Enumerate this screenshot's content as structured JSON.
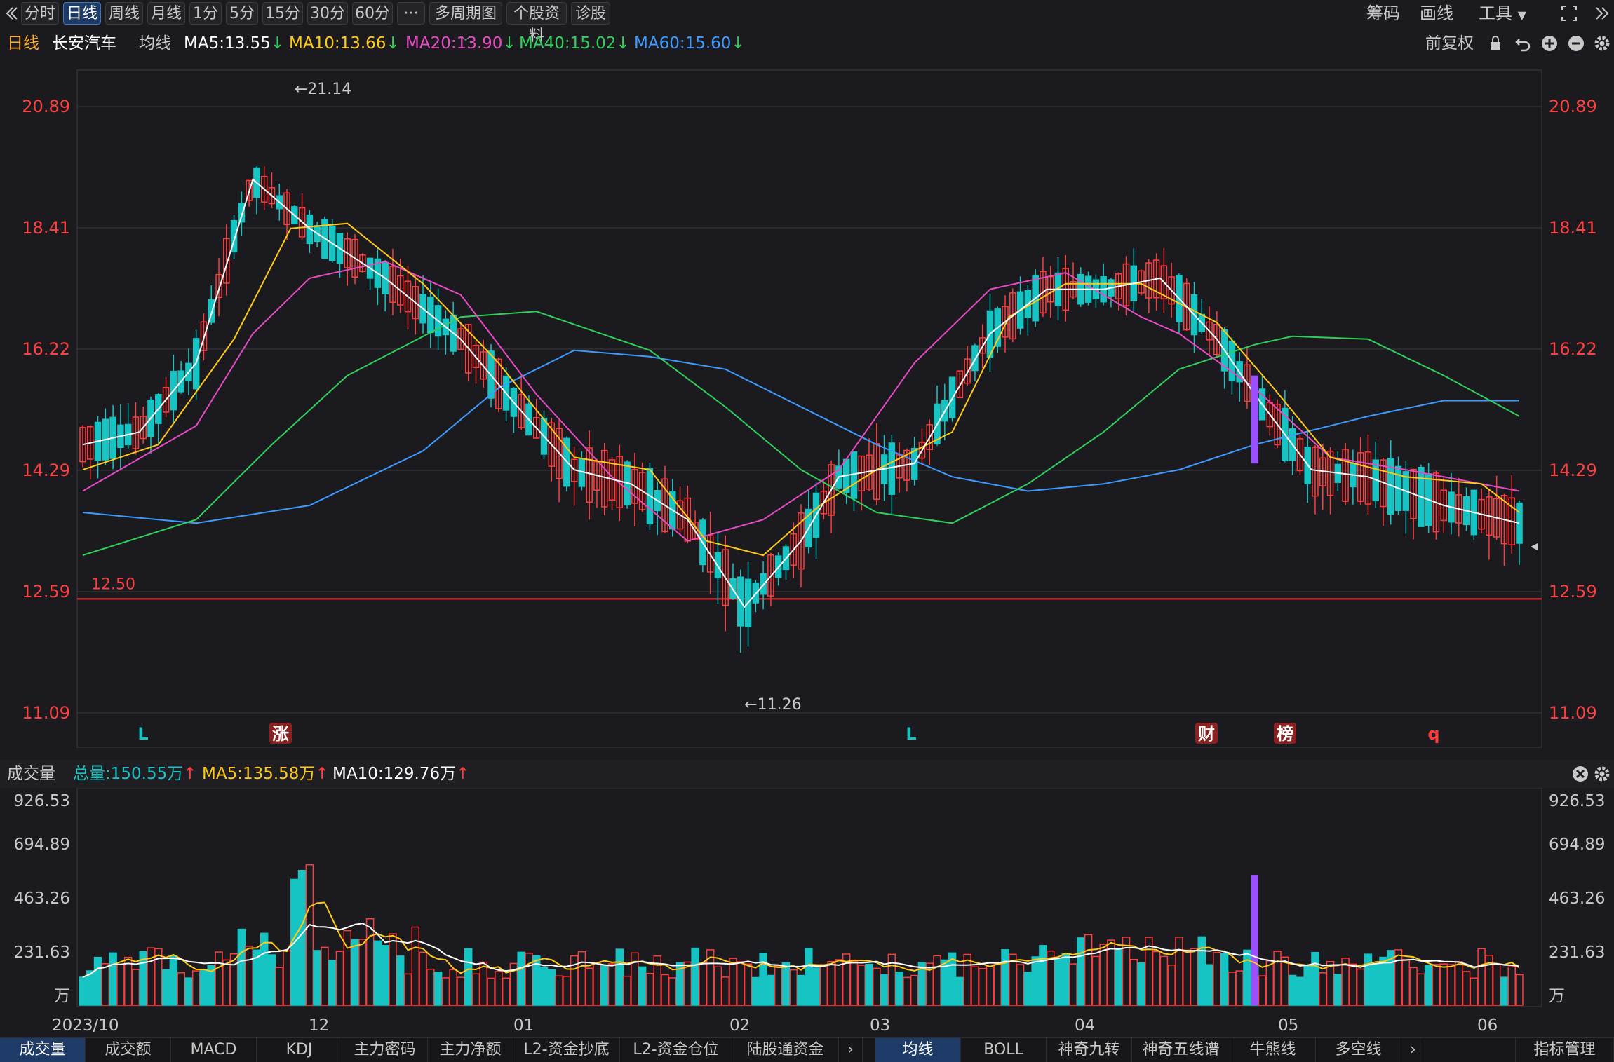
{
  "toolbar": {
    "back_icon": "chevron-left-icon",
    "periods": [
      "分时",
      "日线",
      "周线",
      "月线",
      "1分",
      "5分",
      "15分",
      "30分",
      "60分"
    ],
    "active_period": "日线",
    "more": "···",
    "multi_period": "多周期图",
    "stock_info": "个股资料",
    "diagnose": "诊股",
    "chips": "筹码",
    "draw": "画线",
    "tools": "工具",
    "expand_icon": "fullscreen-icon",
    "collapse_icon": "chevron-right-double-icon"
  },
  "price_header": {
    "period": "日线",
    "stock_name": "长安汽车",
    "avg_label": "均线",
    "ma5": "MA5:13.55",
    "ma10": "MA10:13.66",
    "ma20": "MA20:13.90",
    "ma40": "MA40:15.02",
    "ma60": "MA60:15.60",
    "adjust": "前复权",
    "lock_icon": "lock-icon",
    "undo_icon": "undo-icon",
    "zoom_in_icon": "plus-circle-icon",
    "zoom_out_icon": "minus-circle-icon",
    "settings_icon": "gear-icon"
  },
  "volume_header": {
    "title": "成交量",
    "total": "总量:150.55万",
    "ma5": "MA5:135.58万",
    "ma10": "MA10:129.76万",
    "close_icon": "close-icon",
    "settings_icon": "gear-icon"
  },
  "colors": {
    "up": "#ff3b3b",
    "down": "#16c4c4",
    "ma5": "#ffffff",
    "ma10": "#ffc916",
    "ma20": "#e84ac4",
    "ma40": "#2fcf5b",
    "ma60": "#3d9bff",
    "grid": "#3a3a3f",
    "axis": "#ff4040",
    "marker": "#9b4fff"
  },
  "chart_data": [
    {
      "type": "candlestick",
      "title": "长安汽车 日线",
      "y_ticks": [
        "20.89",
        "18.41",
        "16.22",
        "14.29",
        "12.59",
        "11.09"
      ],
      "ylim": [
        11.09,
        20.89
      ],
      "x_ticks": [
        "2023/10",
        "12",
        "01",
        "02",
        "03",
        "04",
        "05",
        "06"
      ],
      "annotations": {
        "high": "←21.14",
        "low": "←11.26",
        "level": "12.50"
      },
      "level_value": 12.5,
      "events": [
        "L",
        "涨",
        "L",
        "财",
        "榜",
        "q"
      ],
      "series_names": [
        "MA5",
        "MA10",
        "MA20",
        "MA40",
        "MA60"
      ],
      "ma60_points": [
        [
          0,
          13.7
        ],
        [
          30,
          13.55
        ],
        [
          60,
          13.8
        ],
        [
          90,
          14.6
        ],
        [
          110,
          15.6
        ],
        [
          130,
          16.2
        ],
        [
          150,
          16.1
        ],
        [
          170,
          15.9
        ],
        [
          190,
          15.3
        ],
        [
          210,
          14.7
        ],
        [
          230,
          14.2
        ],
        [
          250,
          14.0
        ],
        [
          270,
          14.1
        ],
        [
          290,
          14.3
        ],
        [
          310,
          14.7
        ],
        [
          330,
          15.0
        ],
        [
          340,
          15.15
        ],
        [
          360,
          15.4
        ],
        [
          380,
          15.4
        ]
      ],
      "ma40_points": [
        [
          0,
          13.1
        ],
        [
          30,
          13.6
        ],
        [
          50,
          14.7
        ],
        [
          70,
          15.8
        ],
        [
          100,
          16.8
        ],
        [
          120,
          16.9
        ],
        [
          150,
          16.2
        ],
        [
          170,
          15.3
        ],
        [
          190,
          14.3
        ],
        [
          210,
          13.7
        ],
        [
          230,
          13.55
        ],
        [
          250,
          14.1
        ],
        [
          270,
          14.9
        ],
        [
          290,
          15.9
        ],
        [
          310,
          16.3
        ],
        [
          320,
          16.45
        ],
        [
          340,
          16.4
        ],
        [
          360,
          15.8
        ],
        [
          380,
          15.15
        ]
      ],
      "ma20_points": [
        [
          0,
          14.0
        ],
        [
          30,
          15.0
        ],
        [
          45,
          16.5
        ],
        [
          60,
          17.5
        ],
        [
          80,
          17.8
        ],
        [
          100,
          17.2
        ],
        [
          120,
          15.5
        ],
        [
          140,
          14.2
        ],
        [
          160,
          13.3
        ],
        [
          180,
          13.6
        ],
        [
          200,
          14.3
        ],
        [
          220,
          16.0
        ],
        [
          240,
          17.3
        ],
        [
          260,
          17.6
        ],
        [
          280,
          16.8
        ],
        [
          290,
          16.5
        ],
        [
          310,
          15.6
        ],
        [
          330,
          14.5
        ],
        [
          350,
          14.3
        ],
        [
          380,
          14.0
        ]
      ],
      "ma10_points": [
        [
          0,
          14.3
        ],
        [
          20,
          14.7
        ],
        [
          40,
          16.4
        ],
        [
          55,
          18.4
        ],
        [
          70,
          18.5
        ],
        [
          90,
          17.4
        ],
        [
          110,
          16.0
        ],
        [
          130,
          14.5
        ],
        [
          150,
          14.3
        ],
        [
          165,
          13.3
        ],
        [
          180,
          13.1
        ],
        [
          195,
          13.8
        ],
        [
          210,
          14.3
        ],
        [
          230,
          14.9
        ],
        [
          245,
          16.8
        ],
        [
          260,
          17.4
        ],
        [
          280,
          17.4
        ],
        [
          300,
          16.7
        ],
        [
          315,
          15.6
        ],
        [
          330,
          14.5
        ],
        [
          350,
          14.2
        ],
        [
          370,
          14.1
        ],
        [
          380,
          13.7
        ]
      ],
      "ma5_points": [
        [
          0,
          14.7
        ],
        [
          15,
          14.9
        ],
        [
          30,
          16.0
        ],
        [
          45,
          19.4
        ],
        [
          60,
          18.4
        ],
        [
          80,
          17.5
        ],
        [
          100,
          16.4
        ],
        [
          115,
          15.3
        ],
        [
          130,
          14.3
        ],
        [
          145,
          14.1
        ],
        [
          160,
          13.6
        ],
        [
          175,
          12.4
        ],
        [
          190,
          13.3
        ],
        [
          200,
          14.2
        ],
        [
          220,
          14.4
        ],
        [
          240,
          16.5
        ],
        [
          255,
          17.3
        ],
        [
          270,
          17.3
        ],
        [
          285,
          17.5
        ],
        [
          300,
          16.4
        ],
        [
          310,
          15.5
        ],
        [
          325,
          14.3
        ],
        [
          340,
          14.2
        ],
        [
          360,
          13.8
        ],
        [
          380,
          13.55
        ]
      ]
    },
    {
      "type": "bar",
      "title": "成交量",
      "unit": "万",
      "y_ticks": [
        "926.53",
        "694.89",
        "463.26",
        "231.63",
        "万"
      ],
      "ylim": [
        0,
        926.53
      ],
      "series_names": [
        "成交量",
        "MA5",
        "MA10"
      ]
    }
  ],
  "bottom_tabs": {
    "left": [
      "成交量",
      "成交额",
      "MACD",
      "KDJ",
      "主力密码",
      "主力净额",
      "L2-资金抄底",
      "L2-资金仓位",
      "陆股通资金"
    ],
    "right": [
      "均线",
      "BOLL",
      "神奇九转",
      "神奇五线谱",
      "牛熊线",
      "多空线"
    ],
    "manage": "指标管理",
    "arrow_icon": "chevron-right-icon"
  }
}
